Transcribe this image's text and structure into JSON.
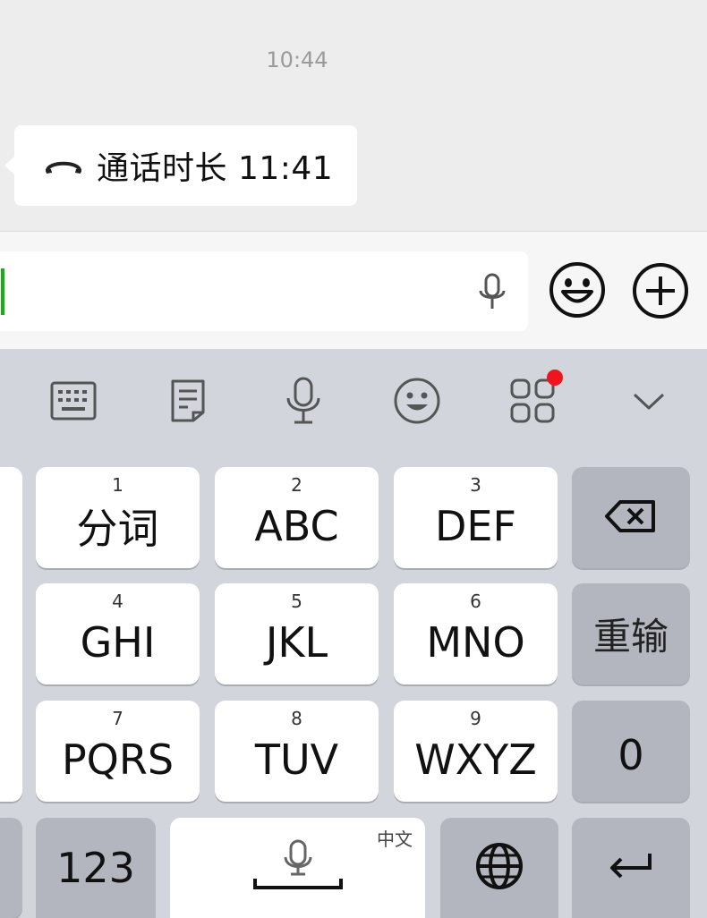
{
  "chat": {
    "timestamp": "10:44",
    "call_message": {
      "icon": "phone-hangup-icon",
      "text": "通话时长 11:41"
    }
  },
  "input_bar": {
    "value": "",
    "mic_icon": "microphone-icon",
    "emoji_icon": "smiley-icon",
    "plus_icon": "plus-circle-icon"
  },
  "keyboard_toolbar": {
    "items": [
      {
        "icon": "keyboard-icon"
      },
      {
        "icon": "clipboard-note-icon"
      },
      {
        "icon": "microphone-icon"
      },
      {
        "icon": "emoji-face-icon"
      },
      {
        "icon": "apps-grid-icon",
        "badge": true
      },
      {
        "icon": "chevron-down-icon"
      }
    ],
    "badge_color": "#f0141e"
  },
  "keys": {
    "row1": [
      {
        "num": "1",
        "label": "分词"
      },
      {
        "num": "2",
        "label": "ABC"
      },
      {
        "num": "3",
        "label": "DEF"
      }
    ],
    "row2": [
      {
        "num": "4",
        "label": "GHI"
      },
      {
        "num": "5",
        "label": "JKL"
      },
      {
        "num": "6",
        "label": "MNO"
      }
    ],
    "row3": [
      {
        "num": "7",
        "label": "PQRS"
      },
      {
        "num": "8",
        "label": "TUV"
      },
      {
        "num": "9",
        "label": "WXYZ"
      }
    ],
    "backspace_icon": "backspace-icon",
    "reset_label": "重输",
    "zero_label": "0",
    "numbers_label": "123",
    "space_lang_label": "中文",
    "globe_icon": "globe-icon",
    "enter_icon": "return-icon"
  },
  "colors": {
    "accent": "#1aad19",
    "chat_bg": "#ededed",
    "keyboard_bg": "#d2d5dc"
  }
}
